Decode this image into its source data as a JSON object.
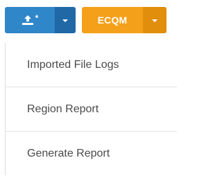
{
  "toolbar": {
    "upload_button": {
      "icon": "upload-icon",
      "badge": "*",
      "color": "#2f86c9",
      "caret_color": "#2069a6"
    },
    "ecqm_button": {
      "label": "ECQM",
      "color": "#f5a01a",
      "caret_color": "#e08e0b"
    }
  },
  "dropdown": {
    "items": [
      {
        "label": "Imported File Logs"
      },
      {
        "label": "Region Report"
      },
      {
        "label": "Generate Report"
      }
    ]
  }
}
